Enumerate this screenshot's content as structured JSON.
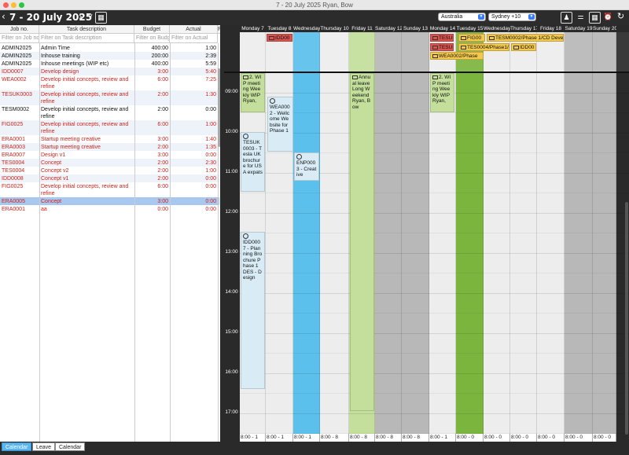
{
  "window": {
    "title": "7 - 20 July 2025  Ryan, Bow"
  },
  "toolbar": {
    "range_label": "7 - 20 July 2025",
    "view_suffix": "V",
    "region": "Australia",
    "timezone": "Sydney +10"
  },
  "left": {
    "headers": [
      "Job no.",
      "Task description",
      "Budget",
      "Actual",
      "F"
    ],
    "filters": [
      "Filter on Job no.",
      "Filter on Task description",
      "Filter on Budge",
      "Filter on Actual"
    ],
    "rows": [
      {
        "job": "ADMIN2025",
        "task": "Admin Time",
        "budget": "400:00",
        "actual": "1:00",
        "red": false
      },
      {
        "job": "ADMIN2025",
        "task": "Inhouse training",
        "budget": "200:00",
        "actual": "2:39",
        "red": false
      },
      {
        "job": "ADMIN2025",
        "task": "Inhouse meetings (WIP etc)",
        "budget": "400:00",
        "actual": "5:59",
        "red": false
      },
      {
        "job": "IDD0007",
        "task": "Develop design",
        "budget": "3:00",
        "actual": "5:40",
        "red": true
      },
      {
        "job": "WEA0002",
        "task": "Develop initial concepts, review and refine",
        "budget": "6:00",
        "actual": "7:25",
        "red": true
      },
      {
        "job": "TESUK0003",
        "task": "Develop initial concepts, review and refine",
        "budget": "2:00",
        "actual": "1:30",
        "red": true
      },
      {
        "job": "TESM0002",
        "task": "Develop initial concepts, review and refine",
        "budget": "2:00",
        "actual": "0:00",
        "red": false
      },
      {
        "job": "FIG0025",
        "task": "Develop initial concepts, review and refine",
        "budget": "6:00",
        "actual": "1:00",
        "red": true
      },
      {
        "job": "ERA0001",
        "task": "Startup meeting creative",
        "budget": "3:00",
        "actual": "1:40",
        "red": true
      },
      {
        "job": "ERA0003",
        "task": "Startup meeting creative",
        "budget": "2:00",
        "actual": "1:35",
        "red": true
      },
      {
        "job": "ERA0007",
        "task": "Design v1",
        "budget": "3:00",
        "actual": "0:00",
        "red": true
      },
      {
        "job": "TES0004",
        "task": "Concept",
        "budget": "2:00",
        "actual": "2:30",
        "red": true
      },
      {
        "job": "TES0004",
        "task": "Concept v2",
        "budget": "2:00",
        "actual": "1:00",
        "red": true
      },
      {
        "job": "IDD0008",
        "task": "Concept v1",
        "budget": "2:00",
        "actual": "0:00",
        "red": true
      },
      {
        "job": "FIG0025",
        "task": "Develop initial concepts, review and refine",
        "budget": "6:00",
        "actual": "0:00",
        "red": true
      },
      {
        "job": "ERA0005",
        "task": "Concept",
        "budget": "3:00",
        "actual": "0:00",
        "red": true,
        "selected": true
      },
      {
        "job": "ERA0001",
        "task": "aa",
        "budget": "0:00",
        "actual": "0:00",
        "red": true
      }
    ]
  },
  "calendar": {
    "days": [
      {
        "label": "Monday 7",
        "footer": "8:00 - 1",
        "color": "#ededed"
      },
      {
        "label": "Tuesday 8",
        "footer": "8:00 - 1",
        "color": "#ededed"
      },
      {
        "label": "Wednesday 9",
        "footer": "8:00 - 1",
        "color": "#5bc0ec"
      },
      {
        "label": "Thursday 10",
        "footer": "8:00 - 8",
        "color": "#ededed"
      },
      {
        "label": "Friday 11",
        "footer": "8:00 - 8",
        "color": "#c3df9b"
      },
      {
        "label": "Saturday 12",
        "footer": "8:00 - 8",
        "color": "#b8b8b8"
      },
      {
        "label": "Sunday 13",
        "footer": "8:00 - 8",
        "color": "#b8b8b8"
      },
      {
        "label": "Monday 14",
        "footer": "8:00 - 1",
        "color": "#ededed"
      },
      {
        "label": "Tuesday 15",
        "footer": "8:00 - 0",
        "color": "#7cb53e"
      },
      {
        "label": "Wednesday 16",
        "footer": "8:00 - 0",
        "color": "#ededed"
      },
      {
        "label": "Thursday 17",
        "footer": "8:00 - 0",
        "color": "#ededed"
      },
      {
        "label": "Friday 18",
        "footer": "8:00 - 0",
        "color": "#ededed"
      },
      {
        "label": "Saturday 19",
        "footer": "8:00 - 0",
        "color": "#b8b8b8"
      },
      {
        "label": "Sunday 20",
        "footer": "8:00 - 0",
        "color": "#b8b8b8"
      }
    ],
    "hours": [
      "09:00",
      "10:00",
      "11:00",
      "12:00",
      "13:00",
      "14:00",
      "15:00",
      "16:00",
      "17:00"
    ],
    "top_tags": [
      {
        "text": "IDD00",
        "bg": "#d9534f"
      },
      {
        "text": "TESUK",
        "bg": "#d9534f"
      },
      {
        "text": "FIG00",
        "bg": "#f3c94d"
      },
      {
        "text": "TESM0002/Phase 1/CD Develop",
        "bg": "#f3c94d"
      },
      {
        "text": "TESUK",
        "bg": "#d9534f"
      },
      {
        "text": "TES0004/Phase1/",
        "bg": "#f3c94d"
      },
      {
        "text": "IDD00",
        "bg": "#f3c94d"
      },
      {
        "text": "WEA0002/Phase",
        "bg": "#f3c94d"
      }
    ],
    "events": [
      {
        "text": "2. WIP meeting Weekly WIP Ryan,",
        "bg": "#c3df9b"
      },
      {
        "text": "TESUK0003 - Tesla UK brochure for USA expats",
        "bg": "#d9ecf6"
      },
      {
        "text": "WEA0002 - Wellcome Website for Phase 1",
        "bg": "#d9ecf6"
      },
      {
        "text": "IDD0007 - Planning Brochure Phase 1 DES - Design",
        "bg": "#d9ecf6"
      },
      {
        "text": "ENP0003 - Creative",
        "bg": "#d9ecf6"
      },
      {
        "text": "Annual leave Long Weekend Ryan, Bow",
        "bg": "#c3df9b"
      },
      {
        "text": "2. WIP meeting Weekly WIP Ryan,",
        "bg": "#c3df9b"
      }
    ]
  },
  "tabs": [
    {
      "label": "Calendar",
      "active": true
    },
    {
      "label": "Leave",
      "active": false
    },
    {
      "label": "Calendar",
      "active": false
    }
  ]
}
